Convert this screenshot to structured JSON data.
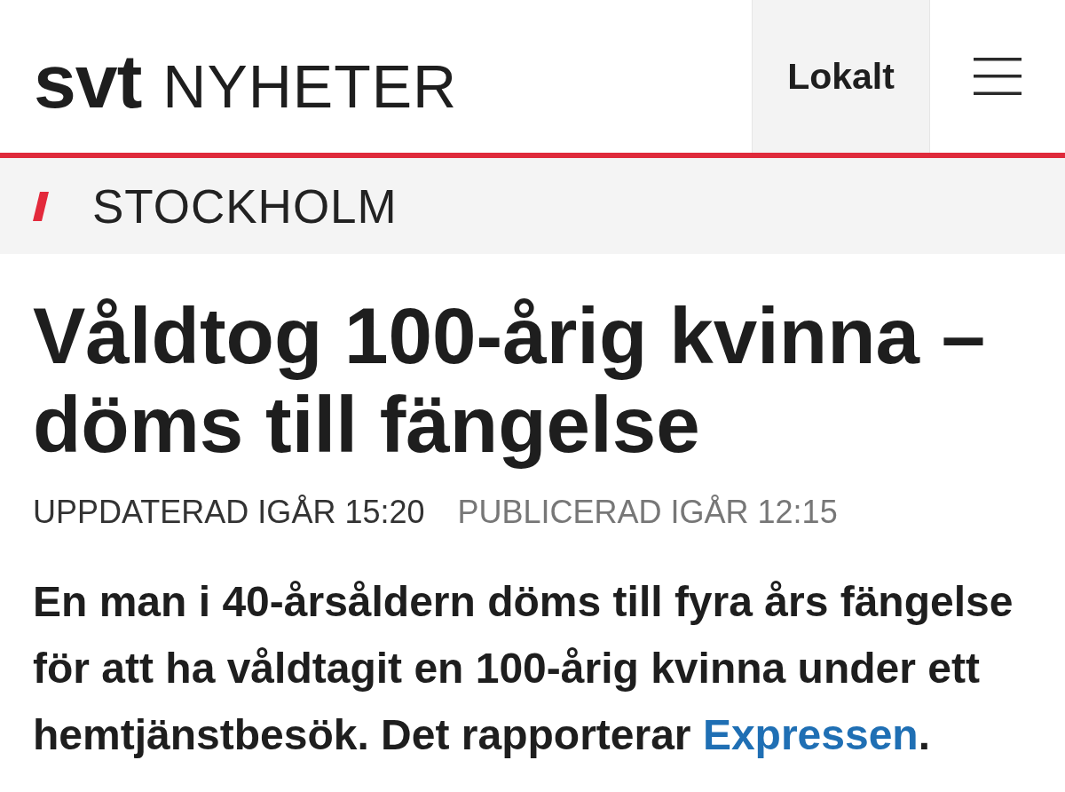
{
  "header": {
    "logo": "svt",
    "site_section": "NYHETER",
    "local_button": {
      "label": "Lokalt"
    }
  },
  "region_bar": {
    "label": "STOCKHOLM"
  },
  "article": {
    "headline": "Våldtog 100-årig kvinna – döms till fängelse",
    "updated": "UPPDATERAD IGÅR 15:20",
    "published": "PUBLICERAD IGÅR 12:15",
    "lead": [
      {
        "kind": "text",
        "text": "En man i 40-årsåldern döms till fyra års fängelse för att ha våldtagit en 100-årig kvinna under ett hemtjänstbesök. Det rapporterar "
      },
      {
        "kind": "link",
        "text": "Expressen"
      },
      {
        "kind": "text",
        "text": "."
      }
    ]
  }
}
